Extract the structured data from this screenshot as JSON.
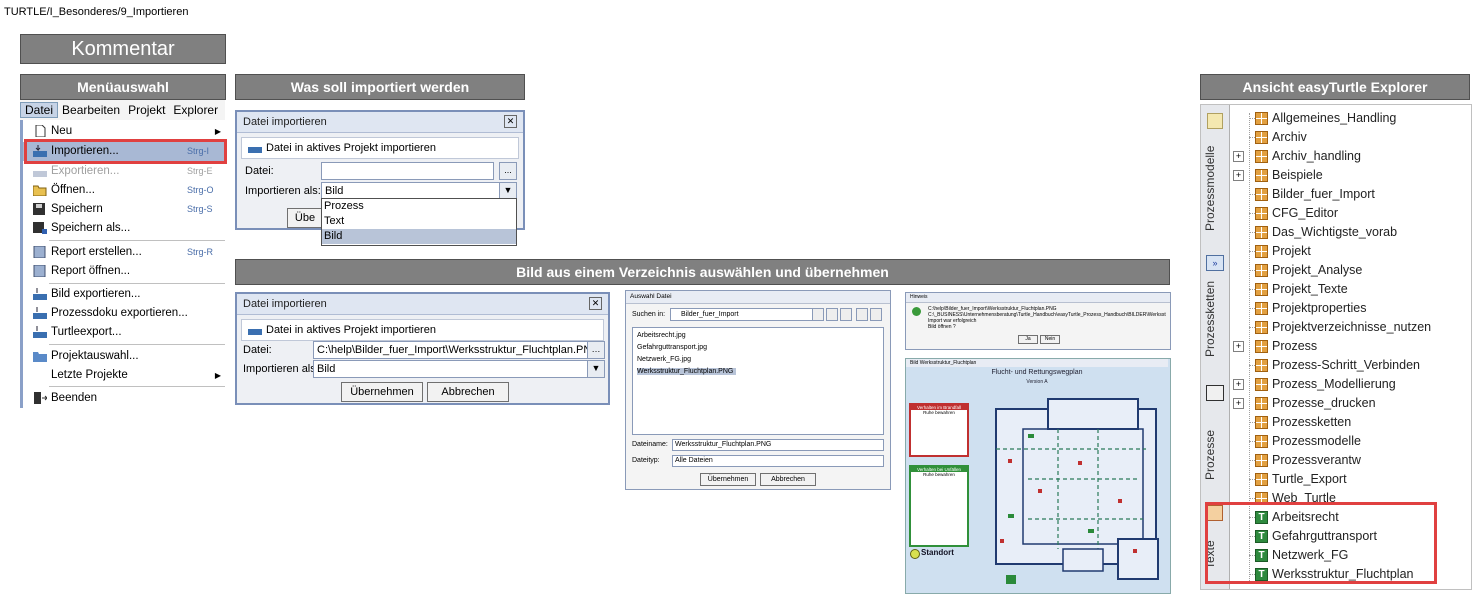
{
  "breadcrumb": "TURTLE/I_Besonderes/9_Importieren",
  "kommentar": "Kommentar",
  "headers": {
    "menu": "Menüauswahl",
    "was": "Was soll importiert werden",
    "bild": "Bild aus einem Verzeichnis auswählen und übernehmen",
    "explorer": "Ansicht easyTurtle Explorer"
  },
  "menubar": [
    "Datei",
    "Bearbeiten",
    "Projekt",
    "Explorer"
  ],
  "menu_items": [
    {
      "label": "Neu",
      "shortcut": ""
    },
    {
      "label": "Importieren...",
      "shortcut": "Strg-I"
    },
    {
      "label": "Exportieren...",
      "shortcut": "Strg-E"
    },
    {
      "label": "Öffnen...",
      "shortcut": "Strg-O"
    },
    {
      "label": "Speichern",
      "shortcut": "Strg-S"
    },
    {
      "label": "Speichern als...",
      "shortcut": ""
    },
    {
      "label": "Report erstellen...",
      "shortcut": "Strg-R"
    },
    {
      "label": "Report öffnen...",
      "shortcut": ""
    },
    {
      "label": "Bild exportieren...",
      "shortcut": ""
    },
    {
      "label": "Prozessdoku exportieren...",
      "shortcut": ""
    },
    {
      "label": "Turtleexport...",
      "shortcut": ""
    },
    {
      "label": "Projektauswahl...",
      "shortcut": ""
    },
    {
      "label": "Letzte Projekte",
      "shortcut": ""
    },
    {
      "label": "Beenden",
      "shortcut": ""
    }
  ],
  "dialog1": {
    "title": "Datei importieren",
    "banner": "Datei in aktives Projekt importieren",
    "datei_label": "Datei:",
    "datei_value": "",
    "import_label": "Importieren als:",
    "import_value": "Bild",
    "button_partial": "Übe",
    "options": [
      "Prozess",
      "Text",
      "Bild"
    ],
    "browse": "..."
  },
  "dialog2": {
    "title": "Datei importieren",
    "banner": "Datei in aktives Projekt importieren",
    "datei_label": "Datei:",
    "datei_value": "C:\\help\\Bilder_fuer_Import\\Werksstruktur_Fluchtplan.PNG",
    "import_label": "Importieren als:",
    "import_value": "Bild",
    "ok": "Übernehmen",
    "cancel": "Abbrechen"
  },
  "filechooser": {
    "title": "Auswahl Datei",
    "suchen_label": "Suchen in:",
    "suchen_value": "Bilder_fuer_Import",
    "files": [
      "Arbeitsrecht.jpg",
      "Gefahrguttransport.jpg",
      "Netzwerk_FG.jpg",
      "Werksstruktur_Fluchtplan.PNG"
    ],
    "dateiname_label": "Dateiname:",
    "dateiname_value": "Werksstruktur_Fluchtplan.PNG",
    "dateityp_label": "Dateityp:",
    "dateityp_value": "Alle Dateien",
    "ok": "Übernehmen",
    "cancel": "Abbrechen"
  },
  "msgbox": {
    "title": "Hinweis",
    "line1": "C:\\help\\Bilder_fuer_Import\\Werksstruktur_Fluchtplan.PNG",
    "line2": "C:\\_BUSINESS\\Unternehmensberatung\\Turtle_Handbuch\\easyTurtle_Prozess_Handbuch\\BILDER\\Werksstruktur_Fluchtplan",
    "line3": "Import war erfolgreich",
    "line4": "Bild öffnen ?",
    "yes": "Ja",
    "no": "Nein"
  },
  "plan": {
    "window_title": "Bild Werksstruktur_Fluchtplan",
    "title": "Flucht- und Rettungswegplan",
    "version": "Version A",
    "box1_title": "Verhalten im Brandfall",
    "box1_sub": "Ruhe bewahren",
    "box2_title": "Verhalten bei Unfällen",
    "box2_sub": "Ruhe bewahren",
    "standort": "Standort",
    "rooms": [
      "Meetingroom",
      "Lager",
      "Spine Treenung",
      "Gästezimmer",
      "Maschinen",
      "Vorratsmat",
      "Nachweiss",
      "Fertigungs",
      "Produktion",
      "Produktion",
      "Produktion",
      "Produktion",
      "Logistik",
      "Sammelpunkt"
    ]
  },
  "explorer": {
    "tabs": [
      "Prozessmodelle",
      "Prozessketten",
      "Prozesse",
      "Texte"
    ],
    "items": [
      {
        "label": "Allgemeines_Handling",
        "type": "grid",
        "exp": false
      },
      {
        "label": "Archiv",
        "type": "grid",
        "exp": false
      },
      {
        "label": "Archiv_handling",
        "type": "grid",
        "exp": true
      },
      {
        "label": "Beispiele",
        "type": "grid",
        "exp": true
      },
      {
        "label": "Bilder_fuer_Import",
        "type": "grid",
        "exp": false
      },
      {
        "label": "CFG_Editor",
        "type": "grid",
        "exp": false
      },
      {
        "label": "Das_Wichtigste_vorab",
        "type": "grid",
        "exp": false
      },
      {
        "label": "Projekt",
        "type": "grid",
        "exp": false
      },
      {
        "label": "Projekt_Analyse",
        "type": "grid",
        "exp": false
      },
      {
        "label": "Projekt_Texte",
        "type": "grid",
        "exp": false
      },
      {
        "label": "Projektproperties",
        "type": "grid",
        "exp": false
      },
      {
        "label": "Projektverzeichnisse_nutzen",
        "type": "grid",
        "exp": false
      },
      {
        "label": "Prozess",
        "type": "grid",
        "exp": true
      },
      {
        "label": "Prozess-Schritt_Verbinden",
        "type": "grid",
        "exp": false
      },
      {
        "label": "Prozess_Modellierung",
        "type": "grid",
        "exp": true
      },
      {
        "label": "Prozesse_drucken",
        "type": "grid",
        "exp": true
      },
      {
        "label": "Prozessketten",
        "type": "grid",
        "exp": false
      },
      {
        "label": "Prozessmodelle",
        "type": "grid",
        "exp": false
      },
      {
        "label": "Prozessverantw",
        "type": "grid",
        "exp": false
      },
      {
        "label": "Turtle_Export",
        "type": "grid",
        "exp": false
      },
      {
        "label": "Web_Turtle",
        "type": "grid",
        "exp": false
      },
      {
        "label": "Arbeitsrecht",
        "type": "img",
        "exp": false
      },
      {
        "label": "Gefahrguttransport",
        "type": "img",
        "exp": false
      },
      {
        "label": "Netzwerk_FG",
        "type": "img",
        "exp": false
      },
      {
        "label": "Werksstruktur_Fluchtplan",
        "type": "img",
        "exp": false
      }
    ]
  },
  "colors": {
    "header_bg": "#808080",
    "highlight": "#e04040",
    "selection": "#a8b8d4"
  }
}
